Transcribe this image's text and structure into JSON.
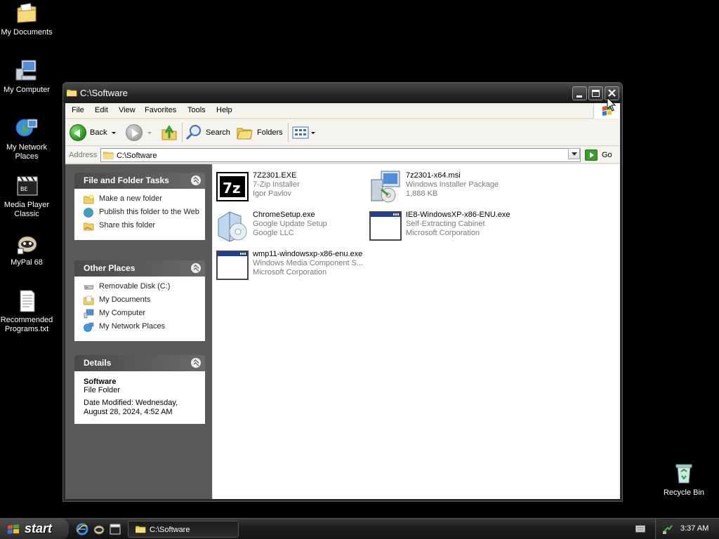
{
  "desktop": {
    "icons": [
      {
        "label": "My Documents",
        "icon": "my-documents-icon"
      },
      {
        "label": "My Computer",
        "icon": "my-computer-icon"
      },
      {
        "label": "My Network Places",
        "icon": "network-places-icon"
      },
      {
        "label": "Media Player Classic",
        "icon": "media-player-classic-icon"
      },
      {
        "label": "MyPal 68",
        "icon": "mypal-icon"
      },
      {
        "label": "Recommended Programs.txt",
        "icon": "text-file-icon"
      },
      {
        "label": "Recycle Bin",
        "icon": "recycle-bin-icon"
      }
    ]
  },
  "window": {
    "title": "C:\\Software",
    "menu": [
      "File",
      "Edit",
      "View",
      "Favorites",
      "Tools",
      "Help"
    ],
    "toolbar": {
      "back": "Back",
      "search": "Search",
      "folders": "Folders"
    },
    "address": {
      "label": "Address",
      "value": "C:\\Software",
      "go": "Go"
    },
    "tasks_panel": {
      "title": "File and Folder Tasks",
      "items": [
        "Make a new folder",
        "Publish this folder to the Web",
        "Share this folder"
      ]
    },
    "places_panel": {
      "title": "Other Places",
      "items": [
        "Removable Disk (C:)",
        "My Documents",
        "My Computer",
        "My Network Places"
      ]
    },
    "details_panel": {
      "title": "Details",
      "name": "Software",
      "type": "File Folder",
      "modified": "Date Modified: Wednesday, August 28, 2024, 4:52 AM"
    },
    "files": [
      {
        "name": "7Z2301.EXE",
        "desc": "7-Zip Installer",
        "meta": "Igor Pavlov",
        "icon": "7zip-icon"
      },
      {
        "name": "7z2301-x64.msi",
        "desc": "Windows Installer Package",
        "meta": "1,888 KB",
        "icon": "msi-installer-icon"
      },
      {
        "name": "ChromeSetup.exe",
        "desc": "Google Update Setup",
        "meta": "Google LLC",
        "icon": "setup-exe-icon"
      },
      {
        "name": "IE8-WindowsXP-x86-ENU.exe",
        "desc": "Self-Extracting Cabinet",
        "meta": "Microsoft Corporation",
        "icon": "app-window-icon"
      },
      {
        "name": "wmp11-windowsxp-x86-enu.exe",
        "desc": "Windows Media Component S...",
        "meta": "Microsoft Corporation",
        "icon": "app-window-icon"
      }
    ]
  },
  "taskbar": {
    "start": "start",
    "task_button": "C:\\Software",
    "clock": "3:37 AM"
  }
}
